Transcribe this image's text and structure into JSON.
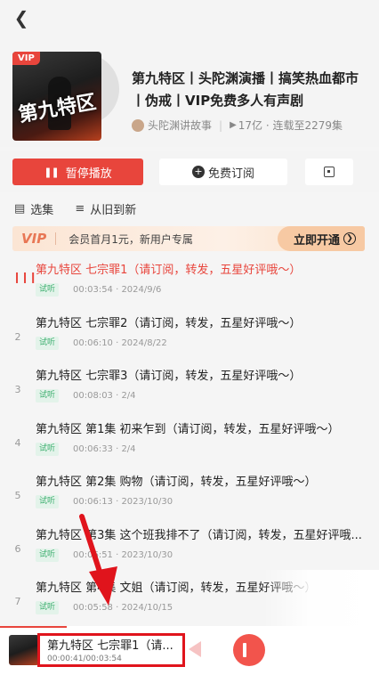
{
  "nav": {
    "back_icon": "chevron-left-icon"
  },
  "album": {
    "cover_badge": "VIP",
    "cover_title": "第九特区",
    "title": "第九特区丨头陀渊演播丨搞笑热血都市丨伪戒丨VIP免费多人有声剧",
    "author": "头陀渊讲故事",
    "play_count": "17亿",
    "updated": "连载至2279集"
  },
  "actions": {
    "pause_label": "暂停播放",
    "subscribe_label": "免费订阅",
    "pause_icon": "pause-icon",
    "subscribe_icon": "plus-circle-icon",
    "scan_icon": "scan-icon"
  },
  "list_header": {
    "select_label": "选集",
    "sort_label": "从旧到新"
  },
  "vip_banner": {
    "logo": "VIP",
    "text": "会员首月1元，新用户专属",
    "cta": "立即开通"
  },
  "episodes": [
    {
      "index": "",
      "title": "第九特区 七宗罪1（请订阅，转发，五星好评哦～）",
      "tag": "试听",
      "meta": "00:03:54 · 2024/9/6",
      "active": true
    },
    {
      "index": "2",
      "title": "第九特区 七宗罪2（请订阅，转发，五星好评哦～）",
      "tag": "试听",
      "meta": "00:06:10 · 2024/8/22"
    },
    {
      "index": "3",
      "title": "第九特区 七宗罪3（请订阅，转发，五星好评哦～）",
      "tag": "试听",
      "meta": "00:08:03 · 2/4"
    },
    {
      "index": "4",
      "title": "第九特区 第1集 初来乍到（请订阅，转发，五星好评哦～）",
      "tag": "试听",
      "meta": "00:06:33 · 2/4"
    },
    {
      "index": "5",
      "title": "第九特区 第2集 购物（请订阅，转发，五星好评哦～）",
      "tag": "试听",
      "meta": "00:06:13 · 2023/10/30"
    },
    {
      "index": "6",
      "title": "第九特区 第3集 这个班我排不了（请订阅，转发，五星好评哦...",
      "tag": "试听",
      "meta": "00:06:51 · 2023/10/30"
    },
    {
      "index": "7",
      "title": "第九特区 第4集 文姐（请订阅，转发，五星好评哦～）",
      "tag": "试听",
      "meta": "00:05:58 · 2024/10/15"
    }
  ],
  "player": {
    "title": "第九特区 七宗罪1（请...",
    "time": "00:00:41/00:03:54",
    "progress_fraction": 0.175
  },
  "colors": {
    "accent": "#e8453c",
    "tag_green": "#3cae6e",
    "annotation_red": "#e0141c"
  }
}
